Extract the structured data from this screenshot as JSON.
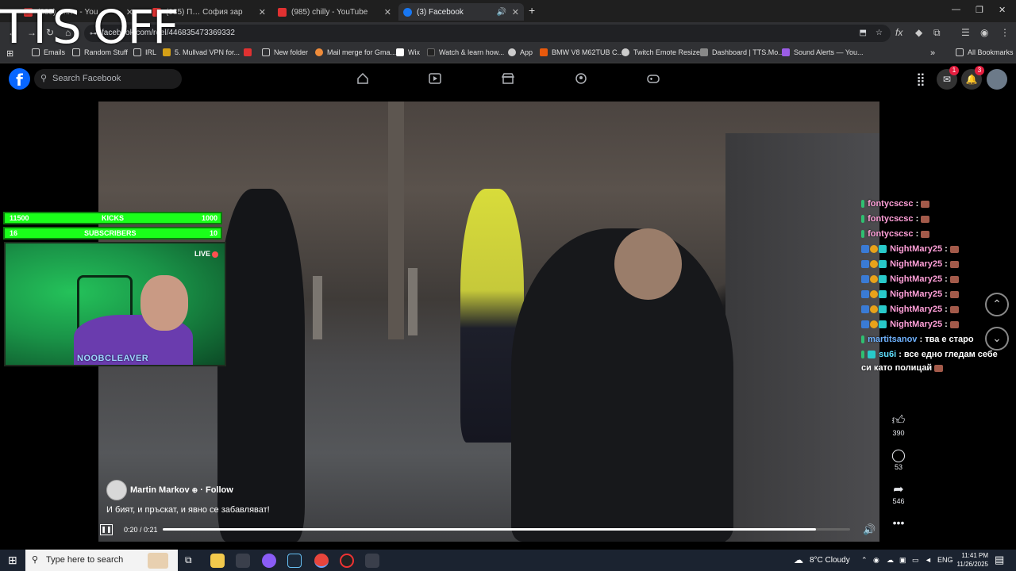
{
  "browser": {
    "tabs": [
      {
        "label": "(985) …кто - You",
        "favicon": "youtube-icon",
        "active": false
      },
      {
        "label": "(985) П… София зар",
        "favicon": "youtube-icon",
        "active": false
      },
      {
        "label": "(985) chilly - YouTube",
        "favicon": "youtube-icon",
        "active": false
      },
      {
        "label": "(3) Facebook",
        "favicon": "facebook-icon",
        "active": true
      }
    ],
    "url": "facebook.com/reel/446835473369332",
    "bookmarks": [
      "Emails",
      "Random Stuff",
      "IRL",
      "5. Mullvad VPN for...",
      "",
      "New folder",
      "Mail merge for Gma...",
      "Wix",
      "Watch & learn how...",
      "App",
      "BMW V8 M62TUB C...",
      "Twitch Emote Resizer",
      "Dashboard | TTS.Mo...",
      "Sound Alerts — You..."
    ],
    "all_bookmarks": "All Bookmarks"
  },
  "facebook": {
    "search_placeholder": "Search Facebook",
    "messenger_badge": "1",
    "notifications_badge": "3"
  },
  "overlay": {
    "tts_banner": "TTS OFF",
    "kicks": {
      "left": "11500",
      "label": "KICKS",
      "right": "1000"
    },
    "subs": {
      "left": "16",
      "label": "SUBSCRIBERS",
      "right": "10"
    },
    "live": "LIVE",
    "streamer": "NOOBCLEAVER",
    "chat": [
      {
        "user": "fontycscsc",
        "msg": "",
        "color": "pink"
      },
      {
        "user": "fontycscsc",
        "msg": "",
        "color": "pink"
      },
      {
        "user": "fontycscsc",
        "msg": "",
        "color": "pink"
      },
      {
        "user": "NightMary25",
        "msg": "",
        "color": "pink"
      },
      {
        "user": "NightMary25",
        "msg": "",
        "color": "pink"
      },
      {
        "user": "NightMary25",
        "msg": "",
        "color": "pink"
      },
      {
        "user": "NightMary25",
        "msg": "",
        "color": "pink"
      },
      {
        "user": "NightMary25",
        "msg": "",
        "color": "pink"
      },
      {
        "user": "NightMary25",
        "msg": "",
        "color": "pink"
      },
      {
        "user": "martitsanov",
        "msg": "тва е старо",
        "color": "blue"
      },
      {
        "user": "su6i",
        "msg": "все едно гледам себе",
        "color": "cyan"
      }
    ],
    "chat_cont": "си като полицай"
  },
  "reel": {
    "author": "Martin Markov",
    "follow": "· Follow",
    "caption": "И бият, и пръскат, и явно се забавляват!",
    "time": "0:20 / 0:21",
    "progress": 0.95,
    "likes": "390",
    "comments": "53",
    "shares": "546"
  },
  "taskbar": {
    "search_placeholder": "Type here to search",
    "weather": "8°C  Cloudy",
    "lang": "ENG",
    "time": "11:41 PM",
    "date": "11/26/2025"
  }
}
